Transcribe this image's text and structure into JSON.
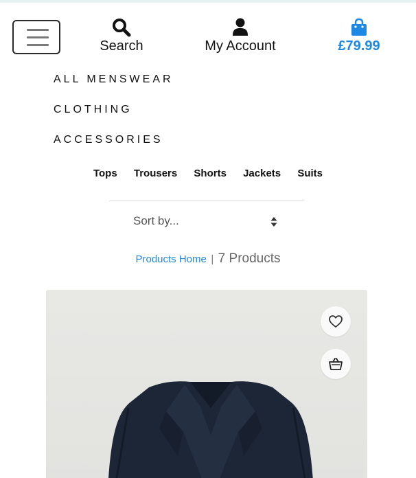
{
  "header": {
    "search_label": "Search",
    "account_label": "My Account",
    "bag_total": "£79.99",
    "icons": [
      "menu-icon",
      "search-icon",
      "user-icon",
      "shopping-bag-icon"
    ],
    "accent_color": "#1e88e5"
  },
  "main_nav": [
    {
      "label": "ALL MENSWEAR"
    },
    {
      "label": "CLOTHING"
    },
    {
      "label": "ACCESSORIES"
    }
  ],
  "sub_nav": [
    {
      "label": "Tops"
    },
    {
      "label": "Trousers"
    },
    {
      "label": "Shorts"
    },
    {
      "label": "Jackets"
    },
    {
      "label": "Suits"
    }
  ],
  "sort": {
    "selected": "Sort by..."
  },
  "breadcrumb": {
    "home": "Products Home",
    "separator": "|",
    "count": "7 Products"
  },
  "product": {
    "actions": [
      "heart-icon",
      "basket-icon"
    ]
  }
}
